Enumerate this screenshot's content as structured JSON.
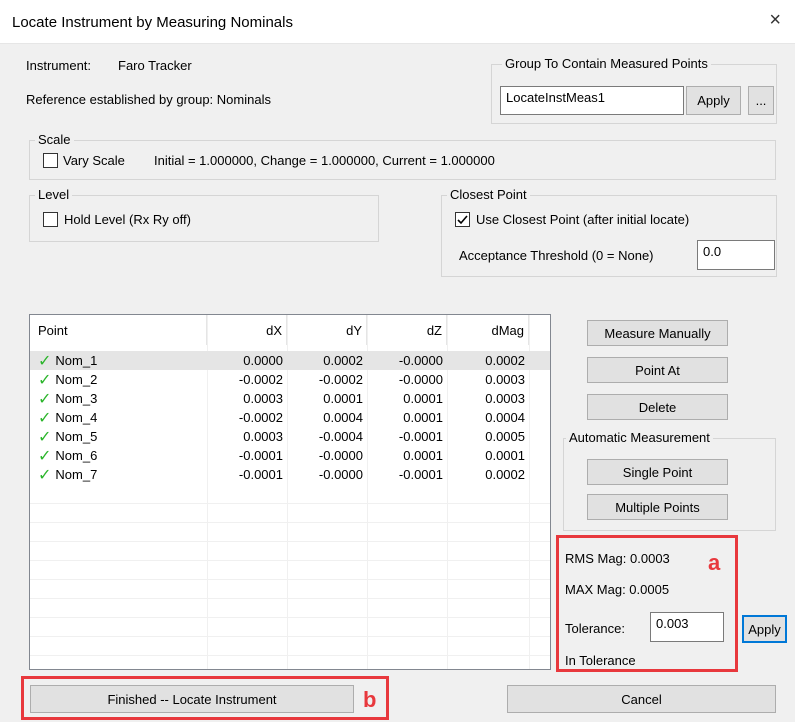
{
  "window": {
    "title": "Locate Instrument by Measuring Nominals",
    "close": "×"
  },
  "instrument": {
    "label": "Instrument:",
    "value": "Faro Tracker"
  },
  "reference": "Reference established by group: Nominals",
  "group_box": {
    "title": "Group To Contain Measured Points",
    "value": "LocateInstMeas1",
    "apply_label": "Apply",
    "browse_label": "..."
  },
  "scale": {
    "title": "Scale",
    "checkbox_label": "Vary Scale",
    "checked": false,
    "info": "Initial = 1.000000, Change = 1.000000, Current = 1.000000"
  },
  "level": {
    "title": "Level",
    "checkbox_label": "Hold Level (Rx Ry off)",
    "checked": false
  },
  "closest_point": {
    "title": "Closest Point",
    "checkbox_label": "Use Closest Point (after initial locate)",
    "checked": true,
    "threshold_label": "Acceptance Threshold (0 = None)",
    "threshold_value": "0.0"
  },
  "table": {
    "columns": [
      "Point",
      "dX",
      "dY",
      "dZ",
      "dMag"
    ],
    "rows": [
      [
        "Nom_1",
        "0.0000",
        "0.0002",
        "-0.0000",
        "0.0002"
      ],
      [
        "Nom_2",
        "-0.0002",
        "-0.0002",
        "-0.0000",
        "0.0003"
      ],
      [
        "Nom_3",
        "0.0003",
        "0.0001",
        "0.0001",
        "0.0003"
      ],
      [
        "Nom_4",
        "-0.0002",
        "0.0004",
        "0.0001",
        "0.0004"
      ],
      [
        "Nom_5",
        "0.0003",
        "-0.0004",
        "-0.0001",
        "0.0005"
      ],
      [
        "Nom_6",
        "-0.0001",
        "-0.0000",
        "0.0001",
        "0.0001"
      ],
      [
        "Nom_7",
        "-0.0001",
        "-0.0000",
        "-0.0001",
        "0.0002"
      ]
    ],
    "check_glyph": "✓"
  },
  "side_buttons": {
    "measure_manually": "Measure Manually",
    "point_at": "Point At",
    "delete": "Delete",
    "auto_title": "Automatic Measurement",
    "single_point": "Single Point",
    "multiple_points": "Multiple Points"
  },
  "stats": {
    "rms": "RMS Mag: 0.0003",
    "max": "MAX Mag: 0.0005",
    "tolerance_label": "Tolerance:",
    "tolerance_value": "0.003",
    "apply_label": "Apply",
    "status": "In Tolerance"
  },
  "footer": {
    "finished_label": "Finished -- Locate Instrument",
    "cancel_label": "Cancel"
  },
  "annotations": {
    "a": "a",
    "b": "b",
    "color": "#e8383d"
  }
}
